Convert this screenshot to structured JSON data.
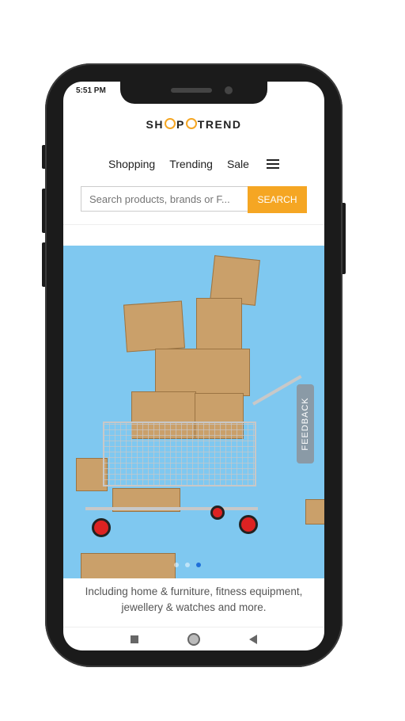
{
  "status_bar": {
    "time": "5:51 PM"
  },
  "brand": {
    "part1": "SH",
    "part2": "P",
    "part3": "TREND",
    "accent": "#f5a623"
  },
  "nav": {
    "items": [
      "Shopping",
      "Trending",
      "Sale"
    ],
    "menu_icon": "hamburger-icon"
  },
  "search": {
    "placeholder": "Search products, brands or F...",
    "button": "SEARCH"
  },
  "hero": {
    "background": "#7fc8f0",
    "feedback_label": "FEEDBACK",
    "slides": 3,
    "active_slide": 3
  },
  "caption": "Including home & furniture, fitness equipment, jewellery & watches and more.",
  "system_nav": {
    "icons": [
      "recent-apps-icon",
      "home-icon",
      "back-icon"
    ]
  }
}
